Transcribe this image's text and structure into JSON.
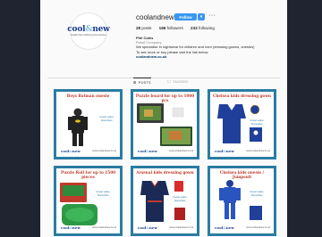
{
  "profile": {
    "username": "coolandnew",
    "follow_label": "Follow",
    "dropdown_icon": "▾",
    "more_icon": "···",
    "avatar": {
      "logo_main": "cool",
      "logo_accent": "new",
      "logo_amp": "&",
      "logo_sub": "Quality Kids Clothing & Accessories"
    },
    "stats": [
      {
        "count": "28",
        "label": "posts"
      },
      {
        "count": "168",
        "label": "followers"
      },
      {
        "count": "233",
        "label": "following"
      }
    ],
    "bio": {
      "name": "Phil Coles",
      "category": "Retail Company",
      "line1": "We specialise in nightwear for children and men (dressing gowns, onesies)",
      "line2": "To see more or buy please visit the link below",
      "link": "coolandnew.co.uk"
    }
  },
  "tabs": [
    {
      "label": "POSTS",
      "icon": "⊞",
      "active": true
    },
    {
      "label": "TAGGED",
      "icon": "☐",
      "active": false
    }
  ],
  "tiles": [
    {
      "title": "Boys Batman onesie",
      "footer_logo": "cool&new",
      "url": "www.coolandnew.co.uk",
      "badge": "Great value Superfast"
    },
    {
      "title": "Puzzle board for up to 1000 pcs",
      "footer_logo": "cool&new",
      "url": "www.coolandnew.co.uk",
      "badge": ""
    },
    {
      "title": "Chelsea kids dressing gown",
      "footer_logo": "cool&new",
      "url": "www.coolandnew.co.uk",
      "badge": "Great value Superfast"
    },
    {
      "title": "Puzzle Roll for up to 1500 pieces",
      "footer_logo": "cool&new",
      "url": "www.coolandnew.co.uk",
      "badge": "Great value Superfast"
    },
    {
      "title": "Arsenal kids dressing gown",
      "footer_logo": "cool&new",
      "url": "www.coolandnew.co.uk",
      "badge": "Great value Superfast"
    },
    {
      "title": "Chelsea kids onesie / Jumpsuit",
      "footer_logo": "cool&new",
      "url": "www.coolandnew.co.uk",
      "badge": "Great value Superfast"
    }
  ],
  "colors": {
    "tile_border": "#2b7ca3",
    "follow": "#3897f0",
    "title_red": "#c0392b",
    "brand_blue": "#1a3c8a"
  }
}
